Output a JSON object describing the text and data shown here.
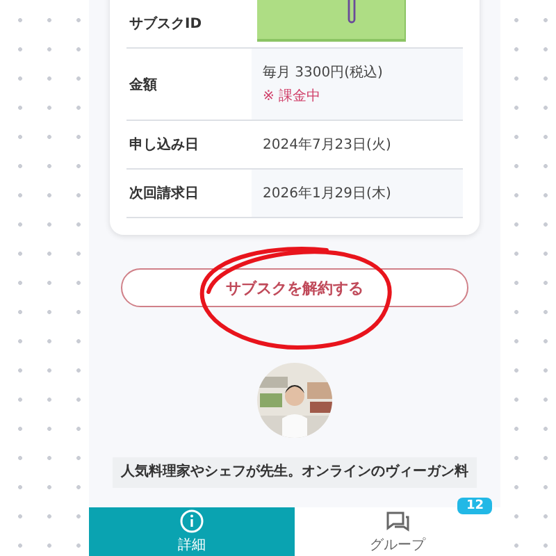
{
  "subscription_table": {
    "rows": [
      {
        "label": "サブスクID"
      },
      {
        "label": "金額",
        "value": "毎月 3300円(税込)",
        "note": "※ 課金中"
      },
      {
        "label": "申し込み日",
        "value": "2024年7月23日(火)"
      },
      {
        "label": "次回請求日",
        "value": "2026年1月29日(木)"
      }
    ]
  },
  "cancel_button": {
    "label": "サブスクを解約する"
  },
  "school": {
    "description": "人気料理家やシェフが先生。オンラインのヴィーガン料"
  },
  "bottom_nav": {
    "tabs": [
      {
        "label": "詳細",
        "selected": true
      },
      {
        "label": "グループ",
        "selected": false,
        "badge": "12"
      }
    ]
  }
}
